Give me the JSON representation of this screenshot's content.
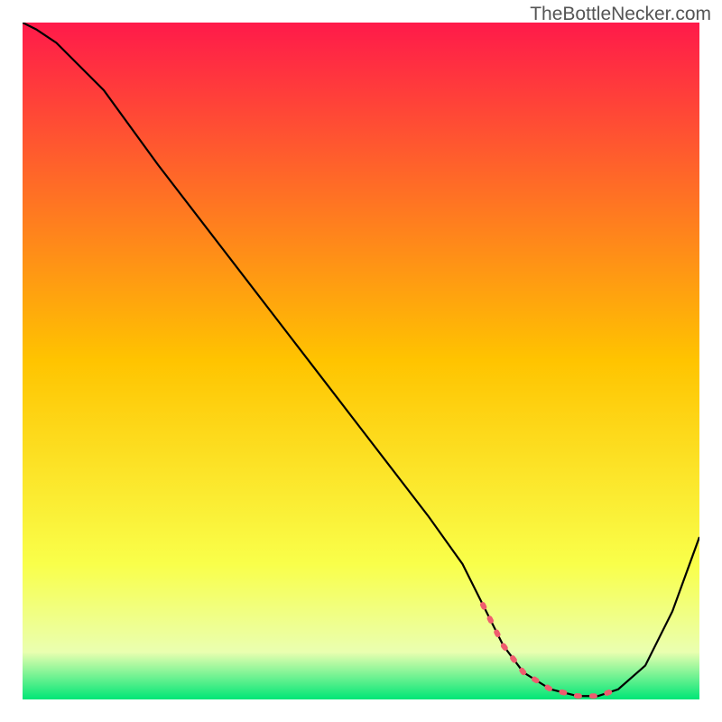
{
  "watermark": "TheBottleNecker.com",
  "chart_data": {
    "type": "line",
    "title": "",
    "xlabel": "",
    "ylabel": "",
    "xlim": [
      0,
      100
    ],
    "ylim": [
      0,
      100
    ],
    "gradient_stops": [
      {
        "offset": 0,
        "color": "#ff1a4a"
      },
      {
        "offset": 50,
        "color": "#ffc400"
      },
      {
        "offset": 80,
        "color": "#f9ff4a"
      },
      {
        "offset": 93,
        "color": "#eaffb0"
      },
      {
        "offset": 100,
        "color": "#00e676"
      }
    ],
    "series": [
      {
        "name": "curve",
        "color": "#000000",
        "x": [
          0,
          2,
          5,
          8,
          12,
          20,
          30,
          40,
          50,
          60,
          65,
          68,
          71,
          74,
          78,
          82,
          85,
          88,
          92,
          96,
          100
        ],
        "y": [
          100,
          99,
          97,
          94,
          90,
          79,
          66,
          53,
          40,
          27,
          20,
          14,
          8,
          4,
          1.5,
          0.5,
          0.5,
          1.5,
          5,
          13,
          24
        ]
      },
      {
        "name": "dashed-highlight",
        "color": "#ef5c6e",
        "dashed": true,
        "x": [
          68,
          71,
          74,
          78,
          82,
          85,
          88
        ],
        "y": [
          14,
          8,
          4,
          1.5,
          0.5,
          0.5,
          1.5
        ]
      }
    ]
  }
}
